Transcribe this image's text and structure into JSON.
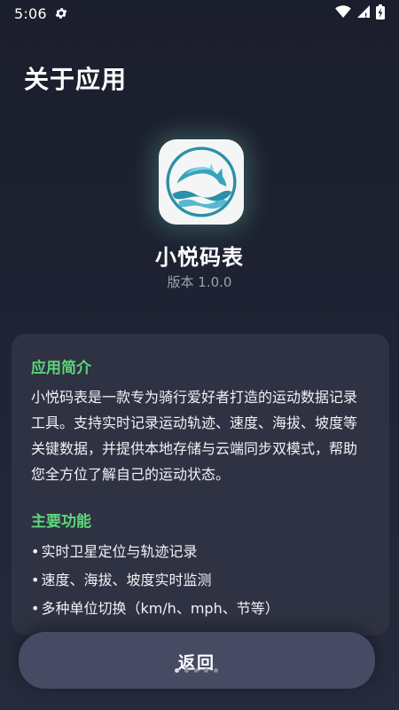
{
  "status_bar": {
    "time": "5:06",
    "icons": [
      "settings-icon",
      "wifi-icon",
      "cellular-signal-icon",
      "battery-charging-icon"
    ]
  },
  "page": {
    "title": "关于应用"
  },
  "app": {
    "icon": "dolphin-logo-icon",
    "name": "小悦码表",
    "version": "版本 1.0.0"
  },
  "intro": {
    "title": "应用简介",
    "body": "小悦码表是一款专为骑行爱好者打造的运动数据记录工具。支持实时记录运动轨迹、速度、海拔、坡度等关键数据，并提供本地存储与云端同步双模式，帮助您全方位了解自己的运动状态。"
  },
  "features": {
    "title": "主要功能",
    "bullet": "•",
    "items": [
      "实时卫星定位与轨迹记录",
      "速度、海拔、坡度实时监测",
      "多种单位切换（km/h、mph、节等）"
    ]
  },
  "back_button": {
    "label": "返回"
  },
  "colors": {
    "background": "#1e2232",
    "card": "#2e3242",
    "accent_green": "#5fd57c",
    "button": "#474a63",
    "muted_text": "#9aa0ad"
  }
}
